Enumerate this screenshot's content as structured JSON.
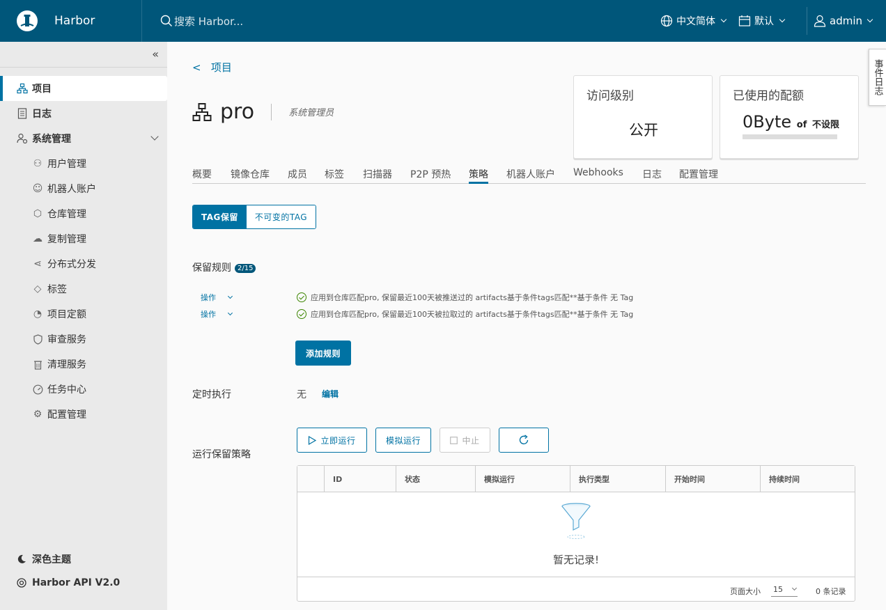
{
  "header": {
    "app_name": "Harbor",
    "search_placeholder": "搜索 Harbor...",
    "language": "中文简体",
    "datetime_format": "默认",
    "user": "admin"
  },
  "sidebar": {
    "collapse_glyph": "«",
    "items": [
      {
        "label": "项目",
        "icon": "projects-icon"
      },
      {
        "label": "日志",
        "icon": "logs-icon"
      },
      {
        "label": "系统管理",
        "icon": "admin-icon"
      }
    ],
    "sub_items": [
      {
        "label": "用户管理",
        "icon": "users-icon"
      },
      {
        "label": "机器人账户",
        "icon": "robot-icon"
      },
      {
        "label": "仓库管理",
        "icon": "registry-icon"
      },
      {
        "label": "复制管理",
        "icon": "replication-icon"
      },
      {
        "label": "分布式分发",
        "icon": "distribution-icon"
      },
      {
        "label": "标签",
        "icon": "tag-icon"
      },
      {
        "label": "项目定额",
        "icon": "quota-icon"
      },
      {
        "label": "审查服务",
        "icon": "shield-icon"
      },
      {
        "label": "清理服务",
        "icon": "trash-icon"
      },
      {
        "label": "任务中心",
        "icon": "dashboard-icon"
      },
      {
        "label": "配置管理",
        "icon": "gear-icon"
      }
    ],
    "theme": "深色主题",
    "api": "Harbor API V2.0"
  },
  "event_log_tab": "事件日志",
  "breadcrumb": {
    "back": "<",
    "label": "项目"
  },
  "project": {
    "name": "pro",
    "role": "系统管理员"
  },
  "cards": {
    "access_title": "访问级别",
    "access_value": "公开",
    "quota_title": "已使用的配额",
    "quota_value": "0Byte",
    "quota_of": "of",
    "quota_limit": "不设限"
  },
  "tabs": [
    "概要",
    "镜像仓库",
    "成员",
    "标签",
    "扫描器",
    "P2P 预热",
    "策略",
    "机器人账户",
    "Webhooks",
    "日志",
    "配置管理"
  ],
  "active_tab": "策略",
  "segment": {
    "on": "TAG保留",
    "off": "不可变的TAG"
  },
  "retention": {
    "label": "保留规则",
    "count": "2/15",
    "rules": [
      {
        "action": "操作",
        "text": "应用到仓库匹配pro, 保留最近100天被推送过的 artifacts基于条件tags匹配**基于条件 无 Tag"
      },
      {
        "action": "操作",
        "text": "应用到仓库匹配pro, 保留最近100天被拉取过的 artifacts基于条件tags匹配**基于条件 无 Tag"
      }
    ],
    "add_button": "添加规则"
  },
  "schedule": {
    "label": "定时执行",
    "value": "无",
    "edit": "编辑"
  },
  "run": {
    "label": "运行保留策略",
    "run_now": "立即运行",
    "dry_run": "模拟运行",
    "abort": "中止",
    "columns": [
      "ID",
      "状态",
      "模拟运行",
      "执行类型",
      "开始时间",
      "持续时间"
    ],
    "empty": "暂无记录!",
    "page_size_label": "页面大小",
    "page_size": "15",
    "record_count": "0 条记录"
  },
  "colors": {
    "header": "#00567a",
    "accent": "#0072a3",
    "success": "#3c8500"
  }
}
